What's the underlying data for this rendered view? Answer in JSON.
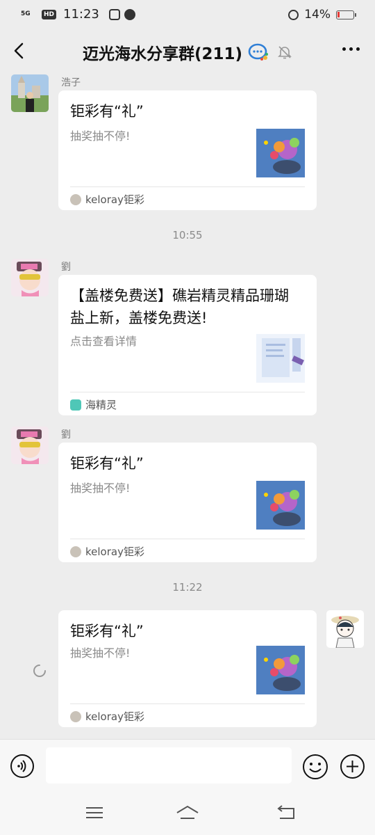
{
  "status_bar": {
    "signal": "5G",
    "hd": "HD",
    "time": "11:23",
    "battery": "14%"
  },
  "nav": {
    "group_title": "迈光海水分享群(211)"
  },
  "messages": [
    {
      "sender": "浩子",
      "card": {
        "title": "钜彩有“礼”",
        "desc": "抽奖抽不停!",
        "source": "keloray钜彩"
      }
    },
    {
      "timestamp": "10:55"
    },
    {
      "sender": "劉",
      "card": {
        "title": "【盖楼免费送】礁岩精灵精品珊瑚盐上新，盖楼免费送!",
        "desc": "点击查看详情",
        "source": "海精灵"
      }
    },
    {
      "sender": "劉",
      "card": {
        "title": "钜彩有“礼”",
        "desc": "抽奖抽不停!",
        "source": "keloray钜彩"
      }
    },
    {
      "timestamp": "11:22"
    },
    {
      "sender": "",
      "card": {
        "title": "钜彩有“礼”",
        "desc": "抽奖抽不停!",
        "source": "keloray钜彩"
      }
    }
  ],
  "input_bar": {
    "text_value": ""
  },
  "colors": {
    "background": "#ededed",
    "card": "#ffffff",
    "battery_low": "#e53935",
    "muted_text": "#8a8a8a"
  },
  "icons": [
    "back-arrow-icon",
    "group-chat-icon",
    "mute-bell-icon",
    "more-icon",
    "voice-icon",
    "emoji-icon",
    "plus-icon",
    "menu-icon",
    "home-icon",
    "back-nav-icon",
    "loading-spinner-icon"
  ]
}
